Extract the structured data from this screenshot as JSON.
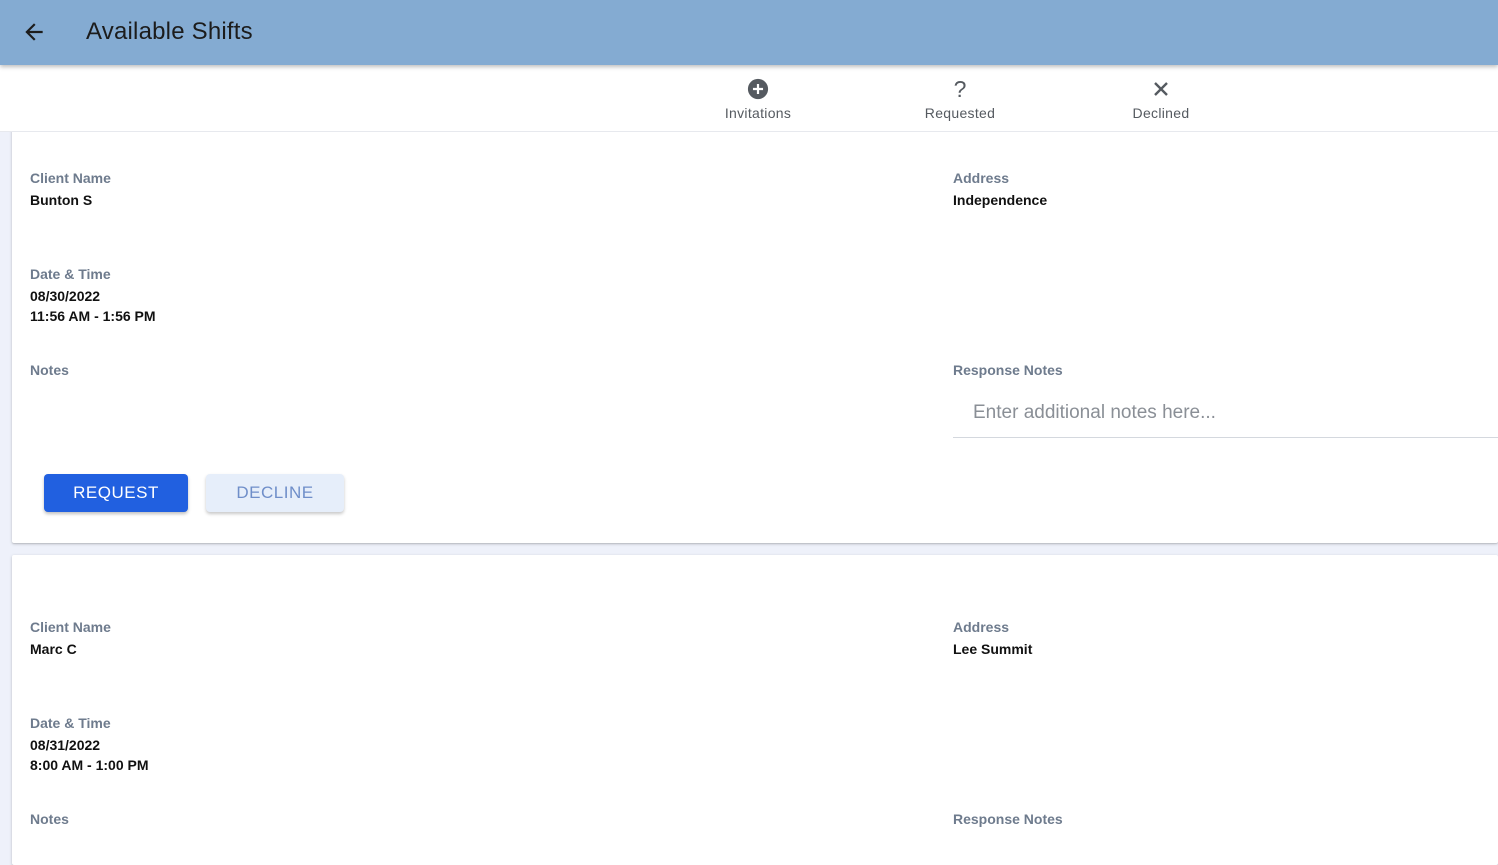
{
  "header": {
    "title": "Available Shifts",
    "back_icon": "arrow-left-icon",
    "background": "#84abd2"
  },
  "tabs": [
    {
      "label": "Invitations",
      "icon": "plus-circle-icon"
    },
    {
      "label": "Requested",
      "icon": "question-icon"
    },
    {
      "label": "Declined",
      "icon": "close-icon"
    }
  ],
  "labels": {
    "client_name": "Client Name",
    "address": "Address",
    "date_time": "Date & Time",
    "notes": "Notes",
    "response_notes": "Response Notes"
  },
  "shifts": [
    {
      "client_name": "Bunton S",
      "address": "Independence",
      "date": "08/30/2022",
      "time": "11:56 AM - 1:56 PM",
      "notes": "",
      "response_placeholder": "Enter additional notes here...",
      "request_label": "REQUEST",
      "decline_label": "DECLINE"
    },
    {
      "client_name": "Marc C",
      "address": "Lee Summit",
      "date": "08/31/2022",
      "time": "8:00 AM - 1:00 PM",
      "notes": ""
    }
  ],
  "colors": {
    "accent": "#2160e0",
    "decline_bg": "#e6eefa",
    "label": "#6e7b8d"
  }
}
